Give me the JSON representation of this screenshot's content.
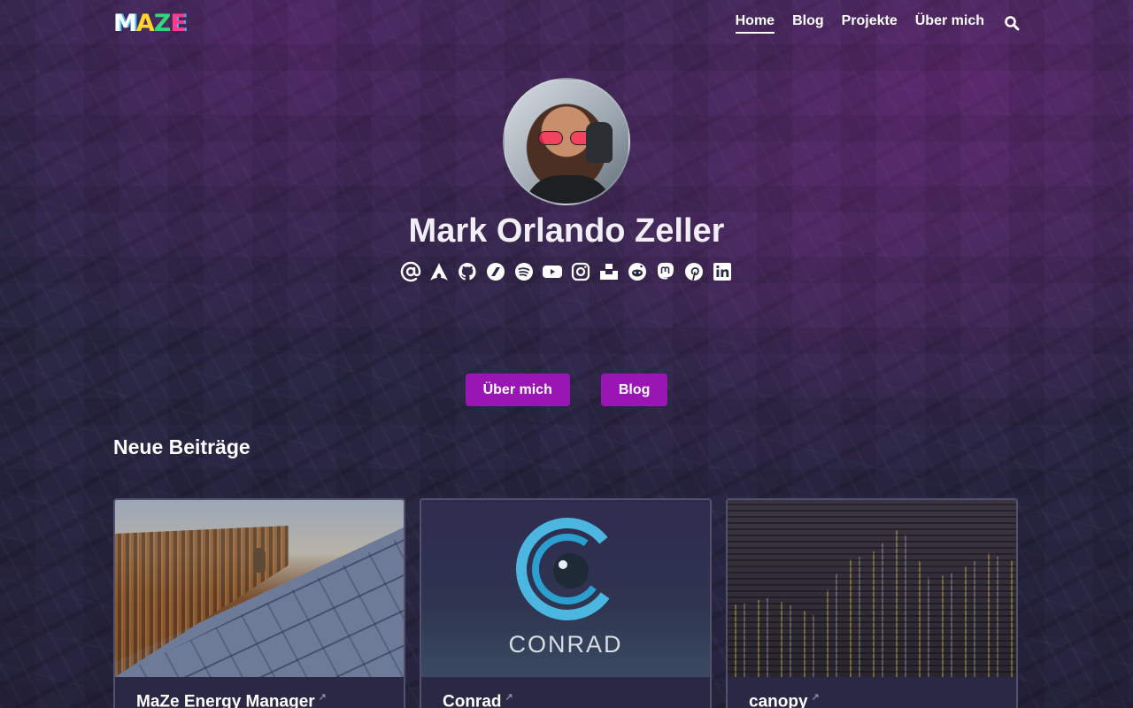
{
  "site": {
    "logo_letters": [
      "M",
      "A",
      "Z",
      "E"
    ]
  },
  "nav": {
    "items": [
      {
        "label": "Home",
        "active": true
      },
      {
        "label": "Blog",
        "active": false
      },
      {
        "label": "Projekte",
        "active": false
      },
      {
        "label": "Über mich",
        "active": false
      }
    ],
    "search_icon": "search-icon"
  },
  "hero": {
    "name": "Mark Orlando Zeller",
    "social_icons": [
      "email-icon",
      "arch-linux-icon",
      "github-icon",
      "codeberg-icon",
      "spotify-icon",
      "youtube-icon",
      "instagram-icon",
      "unsplash-icon",
      "reddit-icon",
      "mastodon-icon",
      "pinterest-icon",
      "linkedin-icon"
    ],
    "buttons": [
      {
        "label": "Über mich"
      },
      {
        "label": "Blog"
      }
    ]
  },
  "posts": {
    "heading": "Neue Beiträge",
    "items": [
      {
        "title": "MaZe Energy Manager",
        "external_icon": "external-link-icon"
      },
      {
        "title": "Conrad",
        "external_icon": "external-link-icon"
      },
      {
        "title": "canopy",
        "external_icon": "external-link-icon"
      }
    ],
    "conrad_logo_text": "CONRAD"
  },
  "colors": {
    "accent": "#9a16b4",
    "background": "#2a2745",
    "text": "#ffffff"
  }
}
